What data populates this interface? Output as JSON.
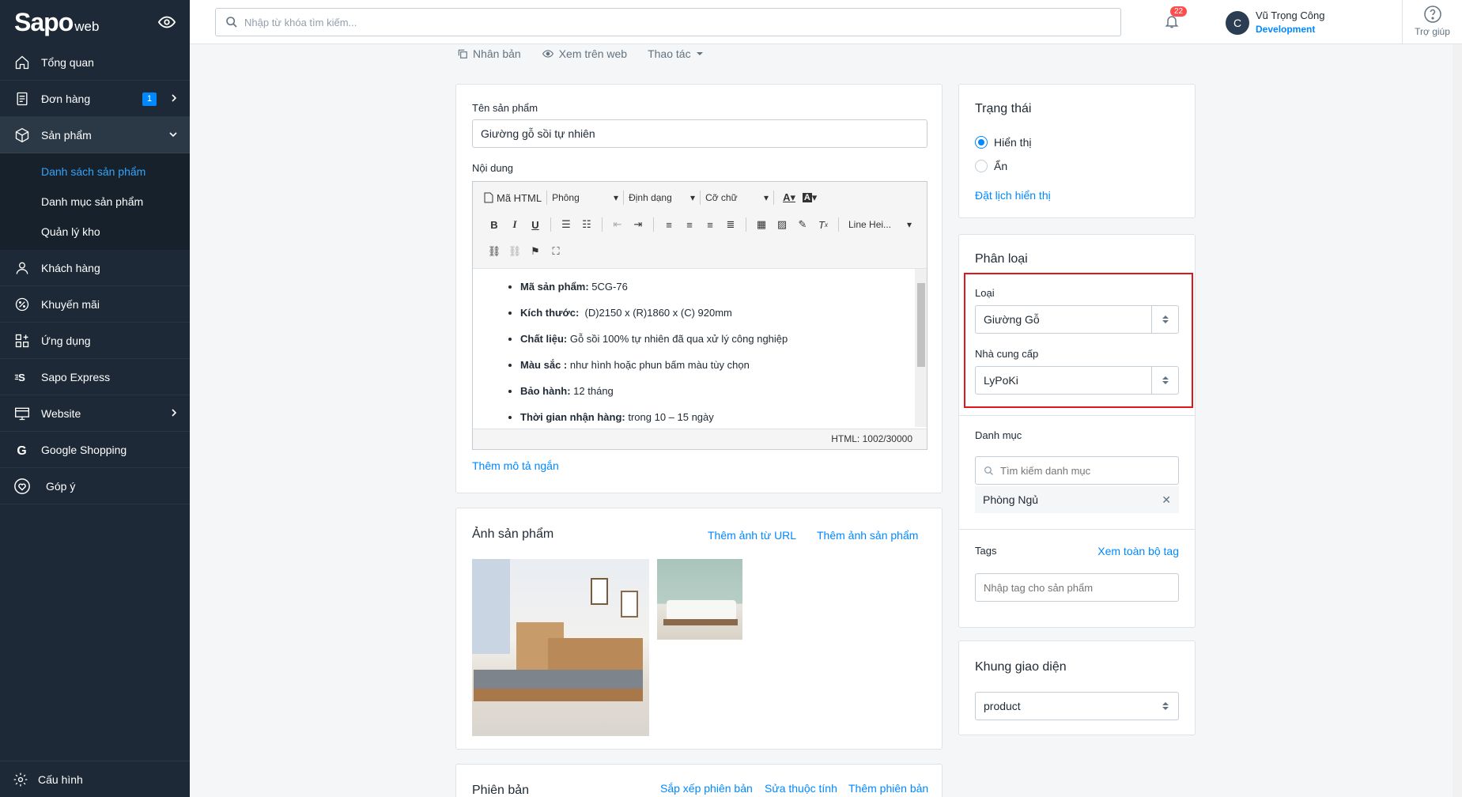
{
  "sidebar": {
    "logo_main": "Sapo",
    "logo_sub": "web",
    "items": [
      {
        "label": "Tổng quan",
        "icon": "home-icon"
      },
      {
        "label": "Đơn hàng",
        "icon": "order-icon",
        "badge": "1"
      },
      {
        "label": "Sản phẩm",
        "icon": "box-icon"
      },
      {
        "label": "Khách hàng",
        "icon": "user-icon"
      },
      {
        "label": "Khuyến mãi",
        "icon": "percent-icon"
      },
      {
        "label": "Ứng dụng",
        "icon": "apps-icon"
      },
      {
        "label": "Sapo Express",
        "icon": "express-icon"
      },
      {
        "label": "Website",
        "icon": "website-icon"
      },
      {
        "label": "Google Shopping",
        "icon": "google-icon"
      },
      {
        "label": "Góp ý",
        "icon": "feedback-icon"
      }
    ],
    "subitems": [
      "Danh sách sản phẩm",
      "Danh mục sản phẩm",
      "Quản lý kho"
    ],
    "bottom": "Cấu hình"
  },
  "topbar": {
    "search_placeholder": "Nhập từ khóa tìm kiếm...",
    "notifications": "22",
    "user_initial": "C",
    "user_name": "Vũ Trọng Công",
    "user_role": "Development",
    "help": "Trợ giúp"
  },
  "actions": {
    "duplicate": "Nhân bản",
    "view_web": "Xem trên web",
    "more": "Thao tác"
  },
  "product": {
    "name_label": "Tên sản phẩm",
    "name_value": "Giường gỗ sồi tự nhiên",
    "content_label": "Nội dung",
    "toolbar": {
      "html": "Mã HTML",
      "font": "Phông",
      "format": "Định dạng",
      "size": "Cỡ chữ",
      "line_height": "Line Hei..."
    },
    "bullets": [
      {
        "key": "Mã sản phẩm:",
        "val": " 5CG-76"
      },
      {
        "key": "Kích thước:",
        "val": "  (D)2150 x (R)1860 x (C) 920mm"
      },
      {
        "key": "Chất liệu:",
        "val": " Gỗ sồi 100%  tự nhiên đã qua xử lý công nghiệp"
      },
      {
        "key": "Màu sắc :",
        "val": " như hình hoặc phun bấm màu tùy chọn"
      },
      {
        "key": "Bảo hành:",
        "val": " 12 tháng"
      },
      {
        "key": "Thời gian nhận hàng:",
        "val": " trong 10 – 15 ngày"
      }
    ],
    "html_count": "HTML: 1002/30000",
    "add_short_desc": "Thêm mô tả ngắn"
  },
  "images": {
    "title": "Ảnh sản phẩm",
    "add_url": "Thêm ảnh từ URL",
    "add_image": "Thêm ảnh sản phẩm"
  },
  "variants": {
    "title": "Phiên bản",
    "sort": "Sắp xếp phiên bản",
    "edit_attr": "Sửa thuộc tính",
    "add": "Thêm phiên bản"
  },
  "status": {
    "title": "Trạng thái",
    "show": "Hiển thị",
    "hide": "Ẩn",
    "schedule": "Đặt lịch hiển thị"
  },
  "classification": {
    "title": "Phân loại",
    "type_label": "Loại",
    "type_value": "Giường Gỗ",
    "vendor_label": "Nhà cung cấp",
    "vendor_value": "LyPoKi",
    "category_label": "Danh mục",
    "category_placeholder": "Tìm kiếm danh mục",
    "category_item": "Phòng Ngủ",
    "tags_label": "Tags",
    "tags_view_all": "Xem toàn bộ tag",
    "tags_placeholder": "Nhập tag cho sản phẩm"
  },
  "template": {
    "title": "Khung giao diện",
    "value": "product"
  },
  "colors": {
    "sidebar": "#1d2936",
    "accent": "#0088ff",
    "highlight": "#e0161b"
  }
}
